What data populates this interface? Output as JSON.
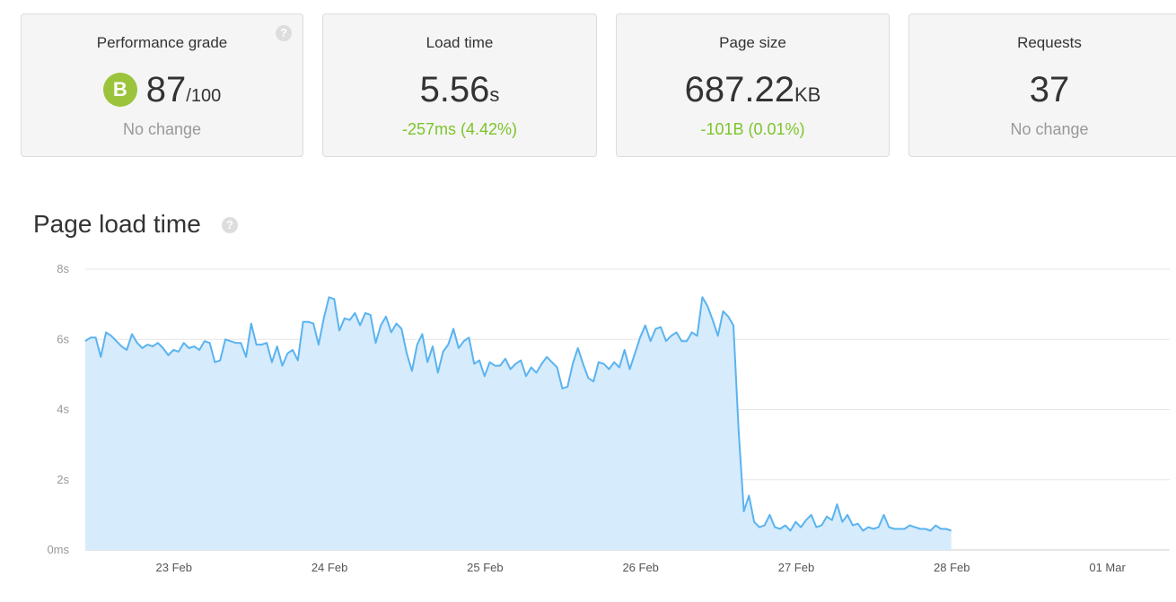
{
  "cards": {
    "grade": {
      "title": "Performance grade",
      "badge": "B",
      "value": "87",
      "denominator": "/100",
      "change": "No change"
    },
    "load_time": {
      "title": "Load time",
      "value": "5.56",
      "unit": "s",
      "change": "-257ms (4.42%)"
    },
    "page_size": {
      "title": "Page size",
      "value": "687.22",
      "unit": "KB",
      "change": "-101B (0.01%)"
    },
    "requests": {
      "title": "Requests",
      "value": "37",
      "change": "No change"
    }
  },
  "help_glyph": "?",
  "section": {
    "title": "Page load time"
  },
  "colors": {
    "line": "#5ab3f0",
    "fill": "#d6ebfb",
    "grade_badge": "#9bc43c",
    "positive": "#7dc42a",
    "neutral": "#999999"
  },
  "chart_data": {
    "type": "area",
    "title": "Page load time",
    "ylim": [
      0,
      8
    ],
    "y_unit": "s",
    "y_ticks": [
      {
        "value": 0,
        "label": "0ms"
      },
      {
        "value": 2,
        "label": "2s"
      },
      {
        "value": 4,
        "label": "4s"
      },
      {
        "value": 6,
        "label": "6s"
      },
      {
        "value": 8,
        "label": "8s"
      }
    ],
    "x_ticks": [
      {
        "pos": 23,
        "label": "23 Feb"
      },
      {
        "pos": 24,
        "label": "24 Feb"
      },
      {
        "pos": 25,
        "label": "25 Feb"
      },
      {
        "pos": 26,
        "label": "26 Feb"
      },
      {
        "pos": 27,
        "label": "27 Feb"
      },
      {
        "pos": 28,
        "label": "28 Feb"
      },
      {
        "pos": 29,
        "label": "01 Mar"
      }
    ],
    "x_start": 22.43,
    "x_step": 0.03333,
    "grid": true,
    "series": [
      {
        "values": [
          5.95,
          6.05,
          6.05,
          5.5,
          6.2,
          6.1,
          5.95,
          5.8,
          5.7,
          6.15,
          5.9,
          5.75,
          5.85,
          5.8,
          5.9,
          5.75,
          5.55,
          5.7,
          5.65,
          5.9,
          5.75,
          5.8,
          5.7,
          5.95,
          5.9,
          5.35,
          5.4,
          6.0,
          5.95,
          5.9,
          5.9,
          5.5,
          6.45,
          5.85,
          5.85,
          5.9,
          5.35,
          5.8,
          5.25,
          5.6,
          5.7,
          5.4,
          6.5,
          6.5,
          6.45,
          5.85,
          6.6,
          7.2,
          7.15,
          6.25,
          6.6,
          6.55,
          6.75,
          6.4,
          6.75,
          6.7,
          5.9,
          6.4,
          6.65,
          6.2,
          6.45,
          6.3,
          5.6,
          5.1,
          5.85,
          6.15,
          5.35,
          5.8,
          5.05,
          5.65,
          5.85,
          6.3,
          5.75,
          5.95,
          6.05,
          5.3,
          5.4,
          4.95,
          5.35,
          5.25,
          5.25,
          5.45,
          5.15,
          5.3,
          5.4,
          4.95,
          5.2,
          5.05,
          5.3,
          5.5,
          5.35,
          5.2,
          4.6,
          4.65,
          5.3,
          5.75,
          5.3,
          4.9,
          4.8,
          5.35,
          5.3,
          5.15,
          5.35,
          5.2,
          5.7,
          5.15,
          5.6,
          6.05,
          6.4,
          5.95,
          6.3,
          6.35,
          5.95,
          6.1,
          6.2,
          5.95,
          5.95,
          6.2,
          6.1,
          7.2,
          6.95,
          6.55,
          6.1,
          6.8,
          6.65,
          6.4,
          3.4,
          1.1,
          1.55,
          0.8,
          0.65,
          0.7,
          1.0,
          0.65,
          0.6,
          0.7,
          0.55,
          0.8,
          0.65,
          0.85,
          1.0,
          0.65,
          0.7,
          0.95,
          0.85,
          1.3,
          0.8,
          1.0,
          0.7,
          0.75,
          0.55,
          0.65,
          0.6,
          0.65,
          1.0,
          0.65,
          0.6,
          0.6,
          0.6,
          0.7,
          0.65,
          0.6,
          0.6,
          0.55,
          0.7,
          0.6,
          0.6,
          0.55
        ]
      }
    ]
  }
}
